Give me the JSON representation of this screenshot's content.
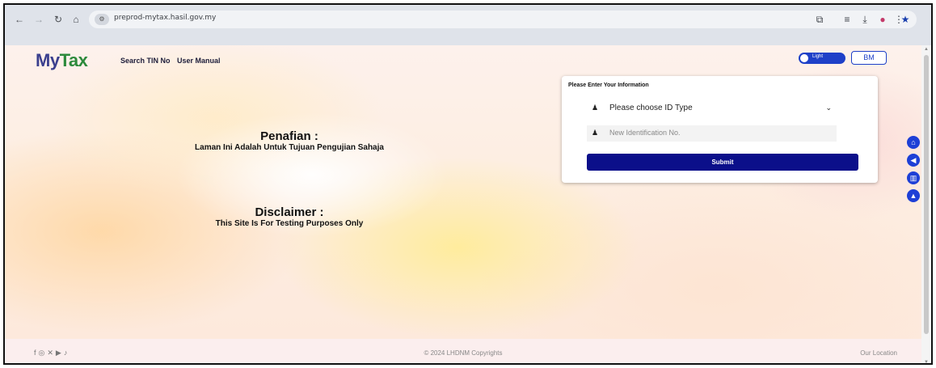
{
  "browser": {
    "url": "preprod-mytax.hasil.gov.my",
    "icons": [
      "back-icon",
      "forward-icon",
      "reload-icon",
      "home-icon",
      "site-info-icon",
      "bookmark-star-icon",
      "extensions-icon",
      "tab-search-icon",
      "download-icon",
      "profile-icon",
      "menu-icon"
    ]
  },
  "header": {
    "logo_my": "My",
    "logo_tax": "Tax",
    "nav": [
      "Search TIN No",
      "User Manual"
    ],
    "theme_toggle_label": "Light",
    "language_button": "BM"
  },
  "notice": {
    "malay_title": "Penafian :",
    "malay_text": "Laman Ini Adalah Untuk Tujuan Pengujian Sahaja",
    "english_title": "Disclaimer :",
    "english_text": "This Site Is For Testing Purposes Only"
  },
  "login_card": {
    "title": "Please Enter Your Information",
    "id_type_placeholder": "Please choose ID Type",
    "id_number_placeholder": "New Identification No.",
    "submit_label": "Submit"
  },
  "side_buttons": [
    "home-icon",
    "megaphone-icon",
    "book-icon",
    "graduation-cap-icon"
  ],
  "footer": {
    "social_icons": [
      "facebook-icon",
      "instagram-icon",
      "x-icon",
      "youtube-icon",
      "tiktok-icon"
    ],
    "copyright": "© 2024 LHDNM Copyrights",
    "location_link": "Our Location"
  },
  "colors": {
    "primary_blue": "#1e40c8",
    "submit_navy": "#0b0f8a",
    "logo_green": "#2c8a3c"
  }
}
